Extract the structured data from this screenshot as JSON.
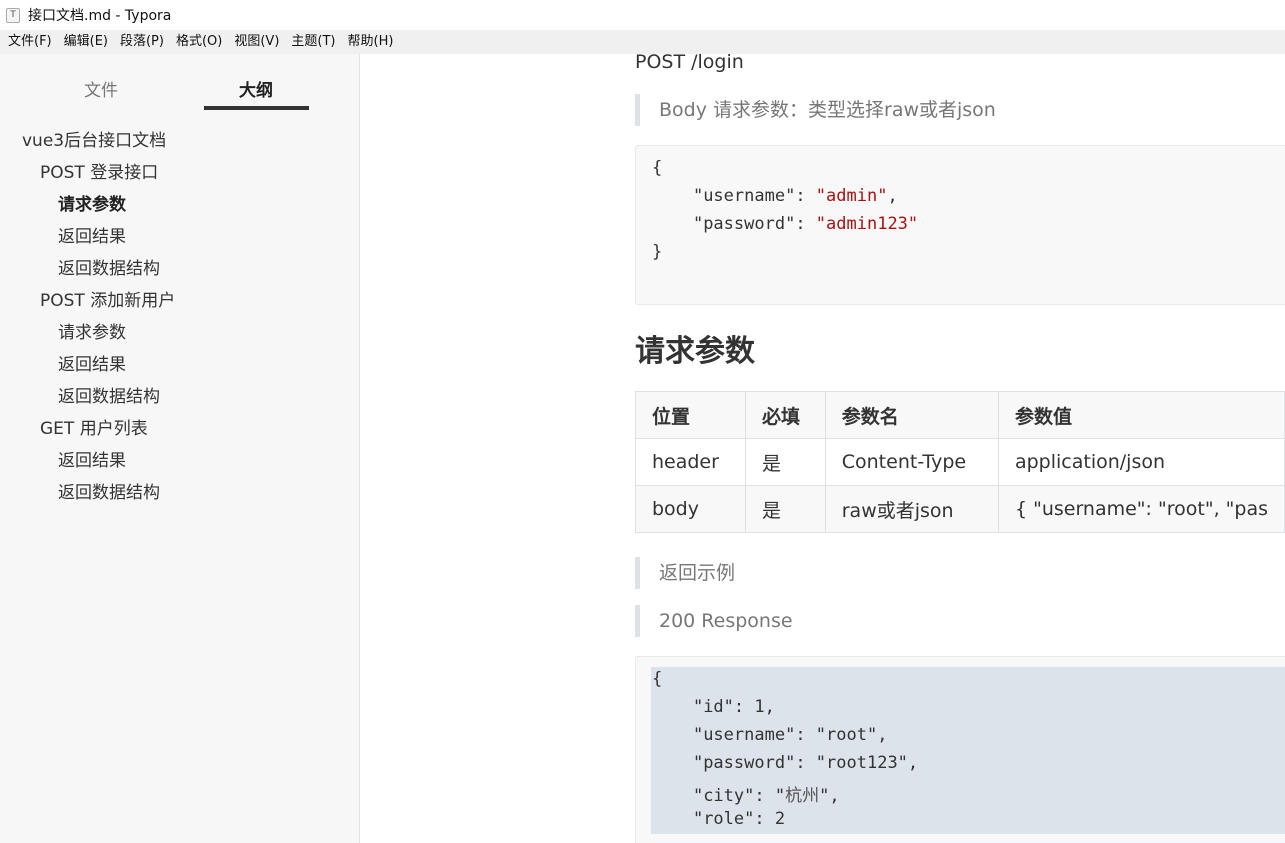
{
  "window": {
    "title": "接口文档.md - Typora",
    "icon_letter": "T"
  },
  "menubar": [
    "文件(F)",
    "编辑(E)",
    "段落(P)",
    "格式(O)",
    "视图(V)",
    "主题(T)",
    "帮助(H)"
  ],
  "sidebar": {
    "tabs": {
      "files": "文件",
      "outline": "大纲"
    },
    "outline": [
      {
        "label": "vue3后台接口文档",
        "level": 1
      },
      {
        "label": "POST 登录接口",
        "level": 2
      },
      {
        "label": "请求参数",
        "level": 3,
        "active": true
      },
      {
        "label": "返回结果",
        "level": 3
      },
      {
        "label": "返回数据结构",
        "level": 3
      },
      {
        "label": "POST 添加新用户",
        "level": 2
      },
      {
        "label": "请求参数",
        "level": 3
      },
      {
        "label": "返回结果",
        "level": 3
      },
      {
        "label": "返回数据结构",
        "level": 3
      },
      {
        "label": "GET 用户列表",
        "level": 2
      },
      {
        "label": "返回结果",
        "level": 3
      },
      {
        "label": "返回数据结构",
        "level": 3
      }
    ]
  },
  "content": {
    "endpoint_line": "POST /login",
    "body_note": "Body 请求参数：类型选择raw或者json",
    "request_code": {
      "open": "{",
      "k1": "\"username\"",
      "v1": "\"admin\"",
      "k2": "\"password\"",
      "v2": "\"admin123\"",
      "close": "}"
    },
    "heading": "请求参数",
    "table": {
      "headers": [
        "位置",
        "必填",
        "参数名",
        "参数值"
      ],
      "rows": [
        [
          "header",
          "是",
          "Content-Type",
          "application/json"
        ],
        [
          "body",
          "是",
          "raw或者json",
          "{ \"username\": \"root\",    \"pas"
        ]
      ]
    },
    "example_note": "返回示例",
    "response_note": "200 Response",
    "response_code": {
      "open": "{",
      "id_key": "\"id\"",
      "id_val": "1",
      "user_key": "\"username\"",
      "user_val": "\"root\"",
      "pwd_key": "\"password\"",
      "pwd_val": "\"root123\"",
      "city_key": "\"city\"",
      "city_val": "杭州",
      "role_key": "\"role\"",
      "role_val": "2"
    }
  }
}
